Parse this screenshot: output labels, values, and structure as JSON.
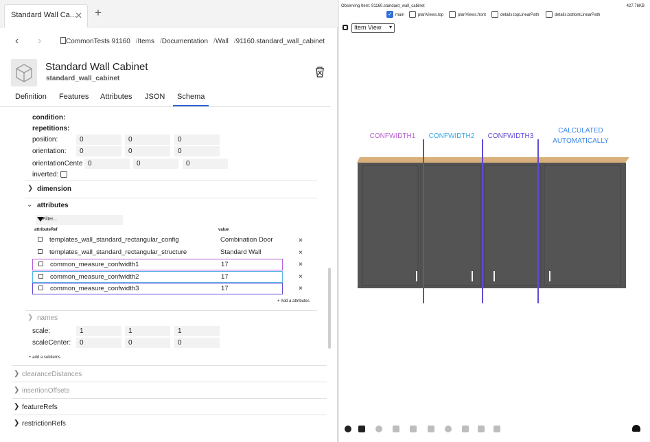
{
  "tab": {
    "title": "Standard Wall Ca...",
    "close": "✕",
    "new": "+"
  },
  "nav": {
    "back": "‹",
    "forward": "›",
    "breadcrumb": [
      "CommonTests 91160",
      "Items",
      "Documentation",
      "Wall",
      "91160.standard_wall_cabinet"
    ]
  },
  "item": {
    "title": "Standard Wall Cabinet",
    "id": "standard_wall_cabinet"
  },
  "tabs": [
    "Definition",
    "Features",
    "Attributes",
    "JSON",
    "Schema"
  ],
  "active_tab": "Schema",
  "schema": {
    "condition_label": "condition:",
    "repetitions_label": "repetitions:",
    "position_label": "position:",
    "position": [
      "0",
      "0",
      "0"
    ],
    "orientation_label": "orientation:",
    "orientation": [
      "0",
      "0",
      "0"
    ],
    "orientationCenter_label": "orientationCente",
    "orientationCenter": [
      "0",
      "0",
      "0"
    ],
    "inverted_label": "inverted:",
    "dimension_label": "dimension",
    "attributes_label": "attributes",
    "filter_placeholder": "Filter...",
    "col_ref": "attributeRef",
    "col_value": "value",
    "attributes": [
      {
        "name": "templates_wall_standard_rectangular_config",
        "value": "Combination Door",
        "highlight": ""
      },
      {
        "name": "templates_wall_standard_rectangular_structure",
        "value": "Standard Wall",
        "highlight": ""
      },
      {
        "name": "common_measure_confwidth1",
        "value": "17",
        "highlight": "#b65fd6"
      },
      {
        "name": "common_measure_confwidth2",
        "value": "17",
        "highlight": "#56b7e6"
      },
      {
        "name": "common_measure_confwidth3",
        "value": "17",
        "highlight": "#5f4bd6"
      }
    ],
    "delete_label": "×",
    "add_attributes": "+ Add a attributes",
    "names_label": "names",
    "scale_label": "scale:",
    "scale": [
      "1",
      "1",
      "1"
    ],
    "scaleCenter_label": "scaleCenter:",
    "scaleCenter": [
      "0",
      "0",
      "0"
    ],
    "add_subitems": "+ add a subitems"
  },
  "sections": [
    "clearanceDistances",
    "insertionOffsets",
    "featureRefs",
    "restrictionRefs"
  ],
  "viewer": {
    "observing": "Observing Item: 91160.standard_wall_cabinet",
    "size": "427.76KB",
    "views": [
      {
        "label": "main",
        "checked": true
      },
      {
        "label": "planViews.top",
        "checked": false
      },
      {
        "label": "planViews.front",
        "checked": false
      },
      {
        "label": "details.topLinearPath",
        "checked": false
      },
      {
        "label": "details.bottomLinearPath",
        "checked": false
      }
    ],
    "view_select": "Item View",
    "annotations": [
      {
        "text": "CONFWIDTH1",
        "color": "#b65fd6"
      },
      {
        "text": "CONFWIDTH2",
        "color": "#3aa7e8"
      },
      {
        "text": "CONFWIDTH3",
        "color": "#5f4bd6"
      },
      {
        "text": "CALCULATED",
        "color": "#3a86e8"
      },
      {
        "text": "AUTOMATICALLY",
        "color": "#3a86e8"
      }
    ],
    "line_colors": [
      "#5f4bd6",
      "#5f4bd6",
      "#5f4bd6"
    ],
    "cabinet_colors": {
      "top": "#d9b07c",
      "body": "#545454",
      "handle": "#f2f2f2"
    }
  }
}
